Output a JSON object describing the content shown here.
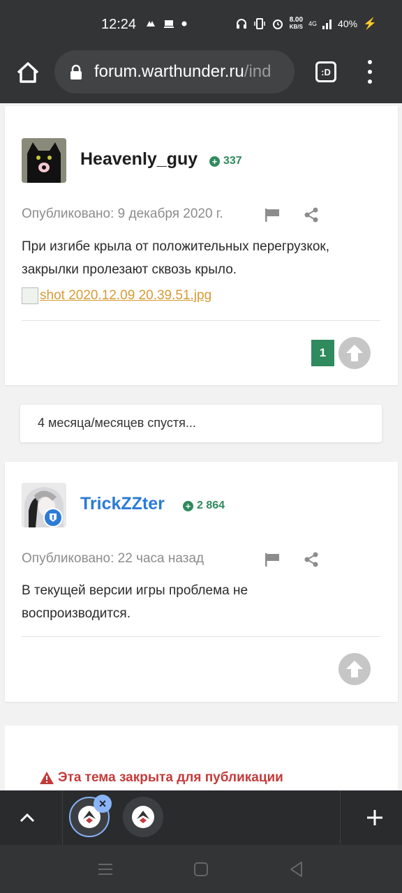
{
  "status_bar": {
    "time": "12:24",
    "speed_value": "8.00",
    "speed_unit": "KB/S",
    "network": "4G",
    "battery": "40%"
  },
  "browser": {
    "url_main": "forum.warthunder.ru",
    "url_rest": "/ind",
    "tabs_label": ":D"
  },
  "posts": [
    {
      "author": "Heavenly_guy",
      "reputation": "337",
      "published": "Опубликовано: 9 декабря 2020 г.",
      "body": "При изгибе крыла от положительных перегрузкок, закрылки пролезают сквозь крыло.",
      "image_link": "shot 2020.12.09 20.39.51.jpg",
      "reactions": "1"
    },
    {
      "author": "TrickZZter",
      "reputation": "2 864",
      "published": "Опубликовано: 22 часа назад",
      "body": "В текущей версии игры проблема не воспроизводится."
    }
  ],
  "time_gap": "4 месяца/месяцев спустя...",
  "locked_message": "Эта тема закрыта для публикации",
  "colors": {
    "reputation_green": "#2f8a5e",
    "link_blue": "#2c7bd6",
    "locked_red": "#c43a3a",
    "image_link_orange": "#d99a34"
  }
}
